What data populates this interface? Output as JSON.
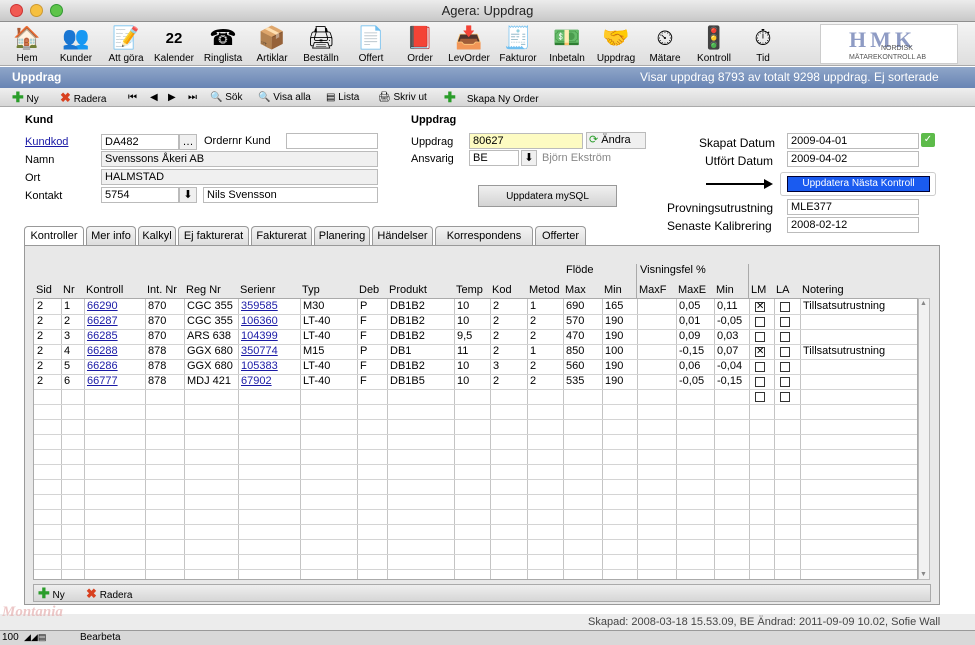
{
  "window": {
    "title": "Agera: Uppdrag"
  },
  "toolbar": {
    "items": [
      {
        "label": "Hem",
        "icon": "home-icon"
      },
      {
        "label": "Kunder",
        "icon": "users-icon"
      },
      {
        "label": "Att göra",
        "icon": "todo-icon"
      },
      {
        "label": "Kalender",
        "icon": "calendar-icon",
        "day": "22"
      },
      {
        "label": "Ringlista",
        "icon": "phone-icon"
      },
      {
        "label": "Artiklar",
        "icon": "box-icon"
      },
      {
        "label": "Beställn",
        "icon": "printer-icon"
      },
      {
        "label": "Offert",
        "icon": "document-icon"
      },
      {
        "label": "Order",
        "icon": "book-icon"
      },
      {
        "label": "LevOrder",
        "icon": "delivery-icon"
      },
      {
        "label": "Fakturor",
        "icon": "invoice-icon"
      },
      {
        "label": "Inbetaln",
        "icon": "money-icon"
      },
      {
        "label": "Uppdrag",
        "icon": "handshake-icon"
      },
      {
        "label": "Mätare",
        "icon": "gauge-icon"
      },
      {
        "label": "Kontroll",
        "icon": "traffic-light-icon"
      },
      {
        "label": "Tid",
        "icon": "stopwatch-icon"
      }
    ]
  },
  "logo": {
    "text": "HMK",
    "sub1": "NORDISK",
    "sub2": "MÄTAREKONTROLL AB"
  },
  "header": {
    "title": "Uppdrag",
    "info": "Visar uppdrag 8793 av totalt 9298 uppdrag. Ej sorterade"
  },
  "nav": {
    "new": "Ny",
    "delete": "Radera",
    "search": "Sök",
    "show_all": "Visa alla",
    "list": "Lista",
    "print": "Skriv ut",
    "create_order": "Skapa Ny Order"
  },
  "kund": {
    "section": "Kund",
    "kundkod_label": "Kundkod",
    "kundkod": "DA482",
    "ordernr_label": "Ordernr Kund",
    "ordernr": "",
    "namn_label": "Namn",
    "namn": "Svenssons Åkeri AB",
    "ort_label": "Ort",
    "ort": "HALMSTAD",
    "kontakt_label": "Kontakt",
    "kontakt_id": "5754",
    "kontakt_namn": "Nils Svensson"
  },
  "uppdrag": {
    "section": "Uppdrag",
    "uppdrag_label": "Uppdrag",
    "uppdrag": "80627",
    "andra": "Ändra",
    "ansvarig_label": "Ansvarig",
    "ansvarig": "BE",
    "ansvarig_namn": "Björn Ekström",
    "mysql_button": "Uppdatera mySQL"
  },
  "dates": {
    "skapat_label": "Skapat Datum",
    "skapat": "2009-04-01",
    "utfort_label": "Utfört Datum",
    "utfort": "2009-04-02",
    "next_button": "Uppdatera Nästa Kontroll",
    "prov_label": "Provningsutrustning",
    "prov": "MLE377",
    "kalib_label": "Senaste Kalibrering",
    "kalib": "2008-02-12"
  },
  "tabs": [
    "Kontroller",
    "Mer info",
    "Kalkyl",
    "Ej fakturerat",
    "Fakturerat",
    "Planering",
    "Händelser",
    "Korrespondens",
    "Offerter"
  ],
  "grid": {
    "group_flode": "Flöde",
    "group_visning": "Visningsfel %",
    "headers": [
      "Sid",
      "Nr",
      "Kontroll",
      "Int. Nr",
      "Reg Nr",
      "Serienr",
      "Typ",
      "Deb",
      "Produkt",
      "Temp",
      "Kod",
      "Metod",
      "Max",
      "Min",
      "MaxF",
      "MaxE",
      "Min",
      "LM",
      "LA",
      "Notering"
    ],
    "rows": [
      [
        "2",
        "1",
        "66290",
        "870",
        "CGC 355",
        "359585",
        "M30",
        "P",
        "DB1B2",
        "10",
        "2",
        "1",
        "690",
        "165",
        "",
        "0,05",
        "0,11",
        true,
        false,
        "Tillsatsutrustning"
      ],
      [
        "2",
        "2",
        "66287",
        "870",
        "CGC 355",
        "106360",
        "LT-40",
        "F",
        "DB1B2",
        "10",
        "2",
        "2",
        "570",
        "190",
        "",
        "0,01",
        "-0,05",
        false,
        false,
        ""
      ],
      [
        "2",
        "3",
        "66285",
        "870",
        "ARS 638",
        "104399",
        "LT-40",
        "F",
        "DB1B2",
        "9,5",
        "2",
        "2",
        "470",
        "190",
        "",
        "0,09",
        "0,03",
        false,
        false,
        ""
      ],
      [
        "2",
        "4",
        "66288",
        "878",
        "GGX 680",
        "350774",
        "M15",
        "P",
        "DB1",
        "11",
        "2",
        "1",
        "850",
        "100",
        "",
        "-0,15",
        "0,07",
        true,
        false,
        "Tillsatsutrustning"
      ],
      [
        "2",
        "5",
        "66286",
        "878",
        "GGX 680",
        "105383",
        "LT-40",
        "F",
        "DB1B2",
        "10",
        "3",
        "2",
        "560",
        "190",
        "",
        "0,06",
        "-0,04",
        false,
        false,
        ""
      ],
      [
        "2",
        "6",
        "66777",
        "878",
        "MDJ 421",
        "67902",
        "LT-40",
        "F",
        "DB1B5",
        "10",
        "2",
        "2",
        "535",
        "190",
        "",
        "-0,05",
        "-0,15",
        false,
        false,
        ""
      ]
    ]
  },
  "panel_nav": {
    "new": "Ny",
    "delete": "Radera"
  },
  "status": {
    "text": "Skapad: 2008-03-18 15.53.09, BE Ändrad: 2011-09-09 10.02, Sofie Wall"
  },
  "bottom": {
    "zoom": "100",
    "mode": "Bearbeta",
    "watermark": "Montania"
  }
}
